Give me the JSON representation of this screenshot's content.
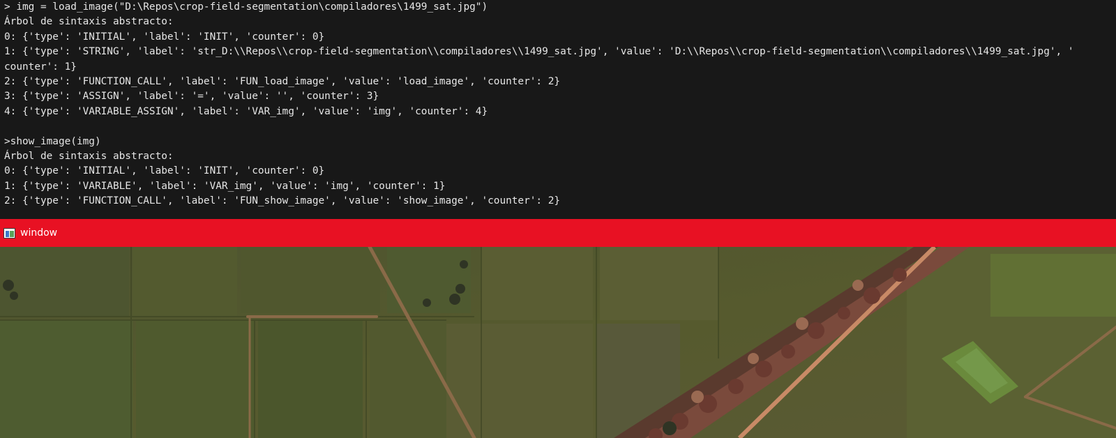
{
  "terminal": {
    "lines": [
      "> img = load_image(\"D:\\Repos\\crop-field-segmentation\\compiladores\\1499_sat.jpg\")",
      "Árbol de sintaxis abstracto:",
      "0: {'type': 'INITIAL', 'label': 'INIT', 'counter': 0}",
      "1: {'type': 'STRING', 'label': 'str_D:\\\\Repos\\\\crop-field-segmentation\\\\compiladores\\\\1499_sat.jpg', 'value': 'D:\\\\Repos\\\\crop-field-segmentation\\\\compiladores\\\\1499_sat.jpg', '",
      "counter': 1}",
      "2: {'type': 'FUNCTION_CALL', 'label': 'FUN_load_image', 'value': 'load_image', 'counter': 2}",
      "3: {'type': 'ASSIGN', 'label': '=', 'value': '', 'counter': 3}",
      "4: {'type': 'VARIABLE_ASSIGN', 'label': 'VAR_img', 'value': 'img', 'counter': 4}",
      "",
      ">show_image(img)",
      "Árbol de sintaxis abstracto:",
      "0: {'type': 'INITIAL', 'label': 'INIT', 'counter': 0}",
      "1: {'type': 'VARIABLE', 'label': 'VAR_img', 'value': 'img', 'counter': 1}",
      "2: {'type': 'FUNCTION_CALL', 'label': 'FUN_show_image', 'value': 'show_image', 'counter': 2}"
    ]
  },
  "window": {
    "title": "window",
    "icon": "app-window-icon",
    "titlebar_color": "#e81123"
  },
  "colors": {
    "terminal_bg": "#181818",
    "terminal_fg": "#e6e6e6"
  }
}
